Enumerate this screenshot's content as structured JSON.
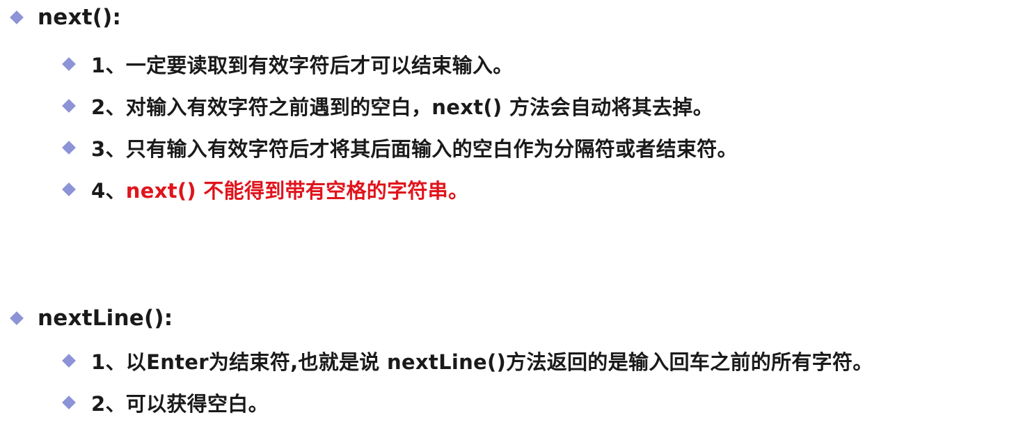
{
  "sections": [
    {
      "heading": "next():",
      "items": [
        {
          "num": "1、",
          "text": "一定要读取到有效字符后才可以结束输入。"
        },
        {
          "num": "2、",
          "text": "对输入有效字符之前遇到的空白，next() 方法会自动将其去掉。"
        },
        {
          "num": "3、",
          "text": "只有输入有效字符后才将其后面输入的空白作为分隔符或者结束符。"
        },
        {
          "num": "4、",
          "text": "next() 不能得到带有空格的字符串。",
          "highlight": true
        }
      ]
    },
    {
      "heading": "nextLine():",
      "items": [
        {
          "num": "1、",
          "text": "以Enter为结束符,也就是说 nextLine()方法返回的是输入回车之前的所有字符。"
        },
        {
          "num": "2、",
          "text": "可以获得空白。"
        }
      ]
    }
  ],
  "colors": {
    "bullet": "#8c93d6",
    "highlight": "#e0141c",
    "text": "#1a1a1a"
  }
}
